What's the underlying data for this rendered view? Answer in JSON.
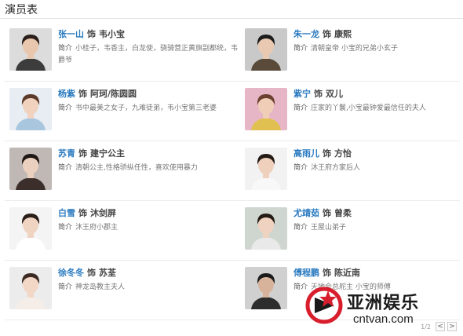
{
  "header": {
    "title": "演员表"
  },
  "as_word": "饰",
  "desc_label": "简介",
  "cast": [
    {
      "actor": "张一山",
      "role": "韦小宝",
      "desc": "小桂子，韦香主，白龙使，骁骑营正黄旗副都统，韦爵爷",
      "photo": {
        "bg": "#dcdcdc",
        "hair": "#2a1f1a",
        "skin": "#e8c7ae",
        "cloth": "#3c3c3c"
      }
    },
    {
      "actor": "朱一龙",
      "role": "康熙",
      "desc": "清朝皇帝 小宝的兄弟小玄子",
      "photo": {
        "bg": "#c9c9c9",
        "hair": "#1c1c1c",
        "skin": "#e9c9b2",
        "cloth": "#5a4a3a"
      }
    },
    {
      "actor": "杨紫",
      "role": "阿珂/陈圆圆",
      "desc": "书中最美之女子，九难徒弟，韦小宝第三老婆",
      "photo": {
        "bg": "#e7edf3",
        "hair": "#5a3b2a",
        "skin": "#f0d2be",
        "cloth": "#a9c6df"
      }
    },
    {
      "actor": "紫宁",
      "role": "双儿",
      "desc": "庄家的丫鬟,小宝最钟爱最信任的夫人",
      "photo": {
        "bg": "#e7b6c6",
        "hair": "#6b4030",
        "skin": "#f0cdb6",
        "cloth": "#e0c050"
      }
    },
    {
      "actor": "苏青",
      "role": "建宁公主",
      "desc": "清朝公主,性格骄纵任性，喜欢使用暴力",
      "photo": {
        "bg": "#bfb8b5",
        "hair": "#1e1714",
        "skin": "#ecd0bf",
        "cloth": "#3b2e2b"
      }
    },
    {
      "actor": "高雨儿",
      "role": "方怡",
      "desc": "沐王府方家后人",
      "photo": {
        "bg": "#f2f2f2",
        "hair": "#241a16",
        "skin": "#eed0bd",
        "cloth": "#f8f8f8"
      }
    },
    {
      "actor": "白雪",
      "role": "沐剑屏",
      "desc": "沐王府小郡主",
      "photo": {
        "bg": "#f4f4f4",
        "hair": "#2a1e18",
        "skin": "#f0d4c2",
        "cloth": "#ffffff"
      }
    },
    {
      "actor": "尤靖茹",
      "role": "曾柔",
      "desc": "王屋山弟子",
      "photo": {
        "bg": "#cfd6cf",
        "hair": "#241b15",
        "skin": "#efd2bf",
        "cloth": "#e9e9e9"
      }
    },
    {
      "actor": "徐冬冬",
      "role": "苏荃",
      "desc": "神龙岛教主夫人",
      "photo": {
        "bg": "#ececec",
        "hair": "#3a2a22",
        "skin": "#f2d6c6",
        "cloth": "#f4ede8"
      }
    },
    {
      "actor": "傅程鹏",
      "role": "陈近南",
      "desc": "天地会总舵主 小宝的师傅",
      "photo": {
        "bg": "#d0d0d0",
        "hair": "#1b1b1b",
        "skin": "#d8b39b",
        "cloth": "#2d2d2d"
      }
    }
  ],
  "pager": {
    "page": "1/2",
    "prev": "<",
    "next": ">"
  },
  "watermark": {
    "brand": "亚洲娱乐",
    "url": "cntvan.com",
    "accent": "#d81e2c"
  }
}
